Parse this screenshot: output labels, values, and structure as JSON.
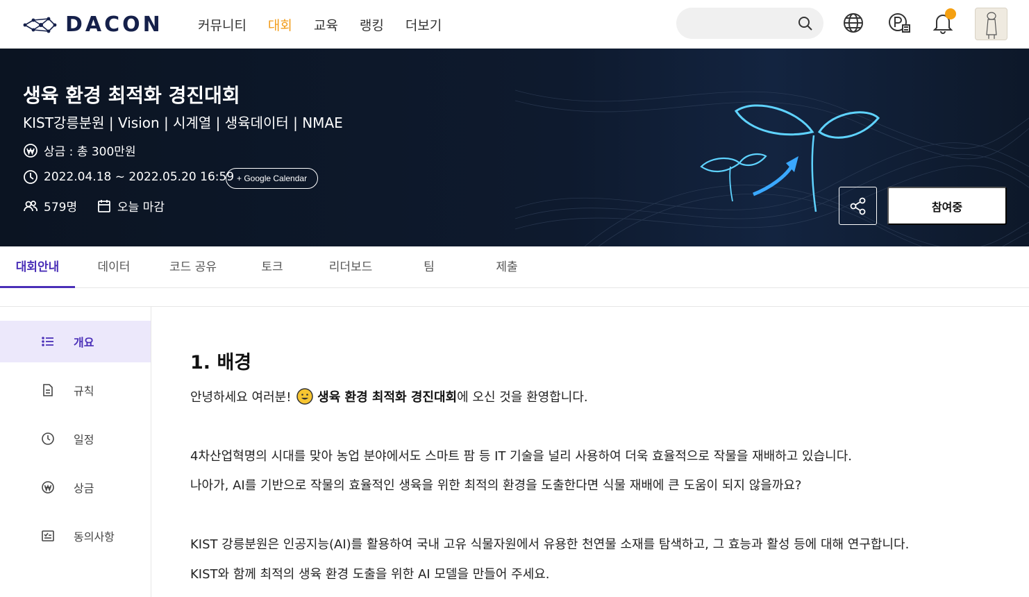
{
  "nav": {
    "logo": "DACON",
    "menu": [
      "커뮤니티",
      "대회",
      "교육",
      "랭킹",
      "더보기"
    ],
    "active_menu": "대회",
    "search_placeholder": ""
  },
  "banner": {
    "title": "생육 환경 최적화 경진대회",
    "tags": "KIST강릉분원 | Vision | 시계열 | 생육데이터 | NMAE",
    "prize": "상금 : 총 300만원",
    "period": "2022.04.18 ~ 2022.05.20 16:59",
    "calendar_button": "+ Google Calendar",
    "participants": "579명",
    "deadline": "오늘 마감",
    "join_button": "참여중"
  },
  "tabs": [
    "대회안내",
    "데이터",
    "코드 공유",
    "토크",
    "리더보드",
    "팀",
    "제출"
  ],
  "active_tab": "대회안내",
  "sidebar": {
    "items": [
      {
        "label": "개요",
        "icon": "list-icon"
      },
      {
        "label": "규칙",
        "icon": "document-icon"
      },
      {
        "label": "일정",
        "icon": "clock-icon"
      },
      {
        "label": "상금",
        "icon": "won-icon"
      },
      {
        "label": "동의사항",
        "icon": "checklist-icon"
      }
    ]
  },
  "content": {
    "heading": "1. 배경",
    "greeting_prefix": "안녕하세요 여러분!",
    "greeting_bold": "생육 환경 최적화 경진대회",
    "greeting_suffix": "에 오신 것을 환영합니다.",
    "para1": "4차산업혁명의 시대를 맞아 농업 분야에서도 스마트 팜 등 IT 기술을 널리 사용하여 더욱 효율적으로 작물을 재배하고 있습니다.",
    "para2": "나아가, AI를 기반으로 작물의 효율적인 생육을 위한 최적의 환경을 도출한다면 식물 재배에 큰 도움이 되지 않을까요?",
    "para3": "KIST 강릉분원은 인공지능(AI)를 활용하여 국내 고유 식물자원에서 유용한 천연물 소재를 탐색하고, 그 효능과 활성 등에 대해 연구합니다.",
    "para4": "KIST와 함께 최적의 생육 환경 도출을 위한 AI 모델을 만들어 주세요."
  },
  "colors": {
    "accent": "#4a2fb8",
    "nav_active": "#f29d1b",
    "banner_bg": "#0e1a2e",
    "notification": "#f5a011"
  }
}
